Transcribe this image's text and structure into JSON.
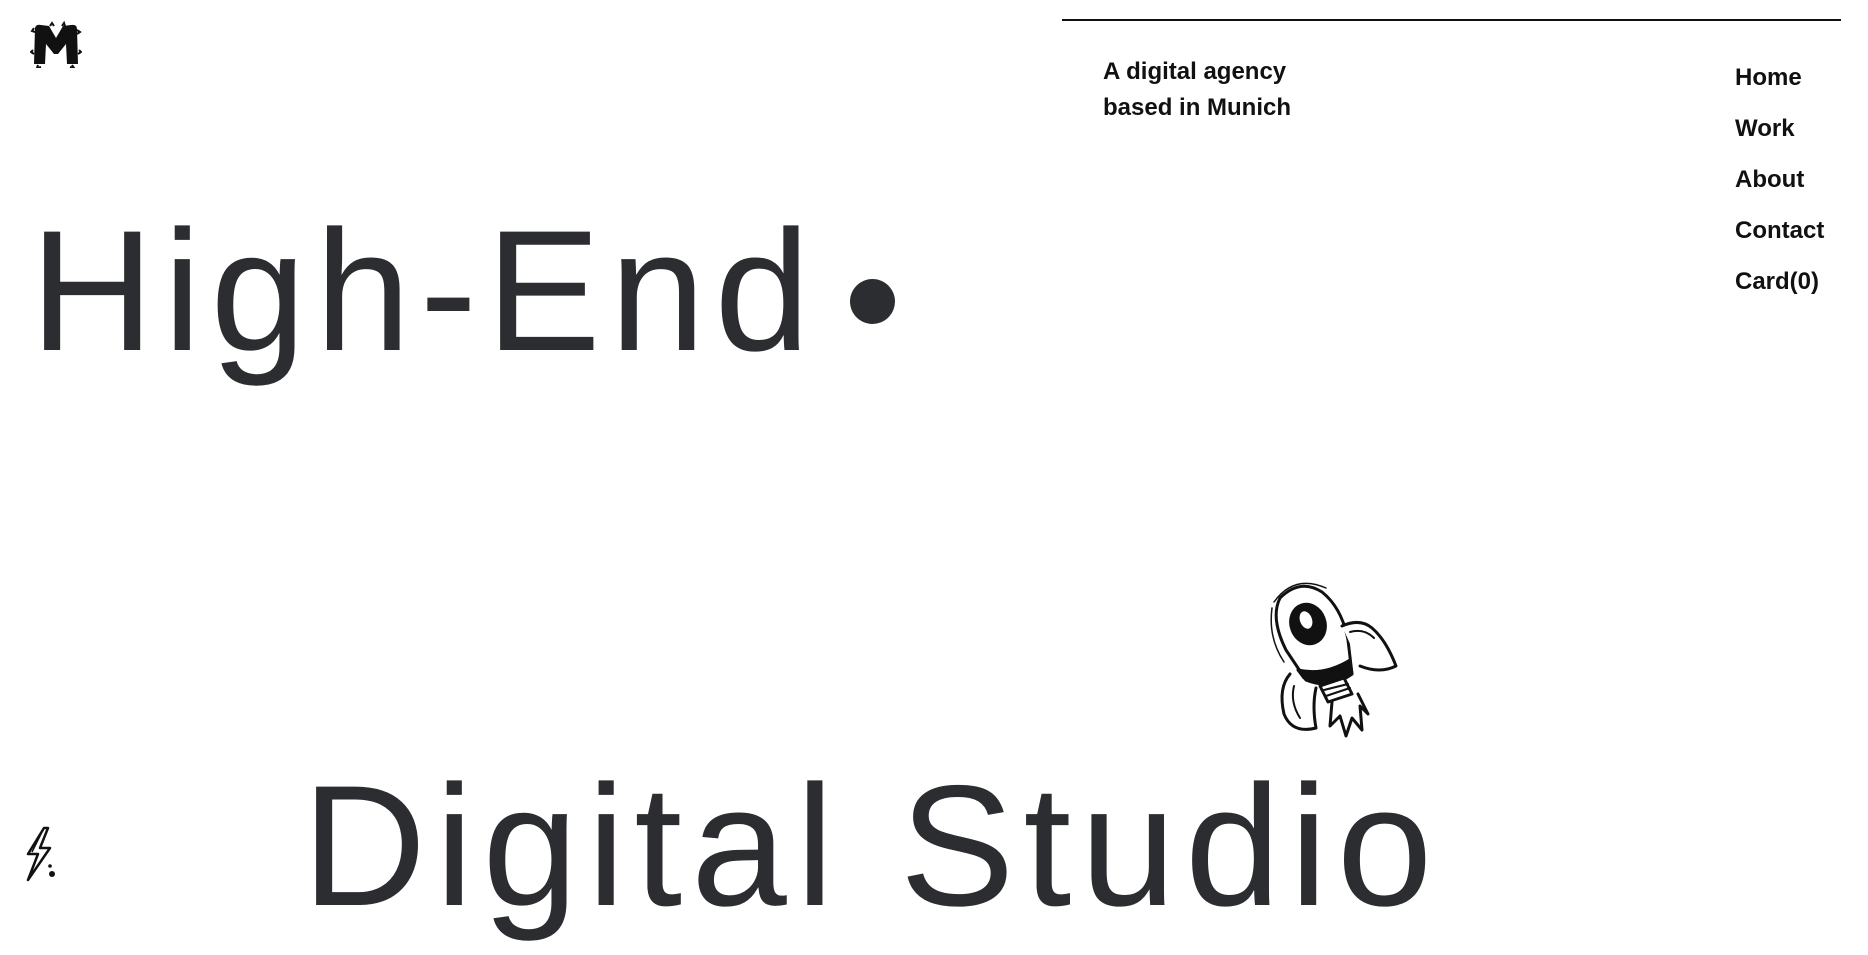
{
  "brand": {
    "logo_letter": "M"
  },
  "header": {
    "tagline_line1": "A digital agency",
    "tagline_line2": "based in Munich"
  },
  "nav": {
    "items": [
      {
        "label": "Home"
      },
      {
        "label": "Work"
      },
      {
        "label": "About"
      },
      {
        "label": "Contact"
      },
      {
        "label": "Card(0)"
      }
    ]
  },
  "hero": {
    "line1": "High-End",
    "line2": "Digital Studio"
  },
  "decor": {
    "rocket_icon": "rocket-icon",
    "bolt_icon": "lightning-bolt-icon"
  },
  "colors": {
    "headline": "#2b2d31",
    "text": "#111111",
    "background": "#ffffff"
  }
}
